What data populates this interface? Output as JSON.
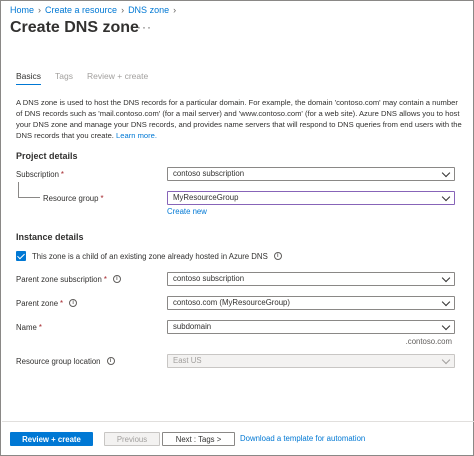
{
  "breadcrumb": {
    "items": [
      "Home",
      "Create a resource",
      "DNS zone"
    ]
  },
  "header": {
    "title": "Create DNS zone",
    "more": "···"
  },
  "tabs": [
    {
      "label": "Basics",
      "active": true
    },
    {
      "label": "Tags",
      "active": false
    },
    {
      "label": "Review + create",
      "active": false
    }
  ],
  "description": {
    "text": "A DNS zone is used to host the DNS records for a particular domain. For example, the domain 'contoso.com' may contain a number of DNS records such as 'mail.contoso.com' (for a mail server) and 'www.contoso.com' (for a web site). Azure DNS allows you to host your DNS zone and manage your DNS records, and provides name servers that will respond to DNS queries from end users with the DNS records that you create.",
    "link": "Learn more."
  },
  "project": {
    "title": "Project details",
    "subscription_label": "Subscription",
    "subscription_value": "contoso subscription",
    "rg_label": "Resource group",
    "rg_value": "MyResourceGroup",
    "create_new": "Create new",
    "required_mark": "*"
  },
  "instance": {
    "title": "Instance details",
    "child_checkbox_label": "This zone is a child of an existing zone already hosted in Azure DNS",
    "child_checked": true,
    "parent_sub_label": "Parent zone subscription",
    "parent_sub_value": "contoso subscription",
    "parent_zone_label": "Parent zone",
    "parent_zone_value": "contoso.com (MyResourceGroup)",
    "name_label": "Name",
    "name_value": "subdomain",
    "name_suffix": ".contoso.com",
    "rg_location_label": "Resource group location",
    "rg_location_value": "East US"
  },
  "footer": {
    "review_create": "Review + create",
    "previous": "Previous",
    "next": "Next : Tags >",
    "download": "Download a template for automation"
  },
  "icons": {
    "info": "i"
  },
  "colors": {
    "accent": "#0078d4",
    "required": "#a4262c",
    "focus_border": "#8764b8"
  }
}
